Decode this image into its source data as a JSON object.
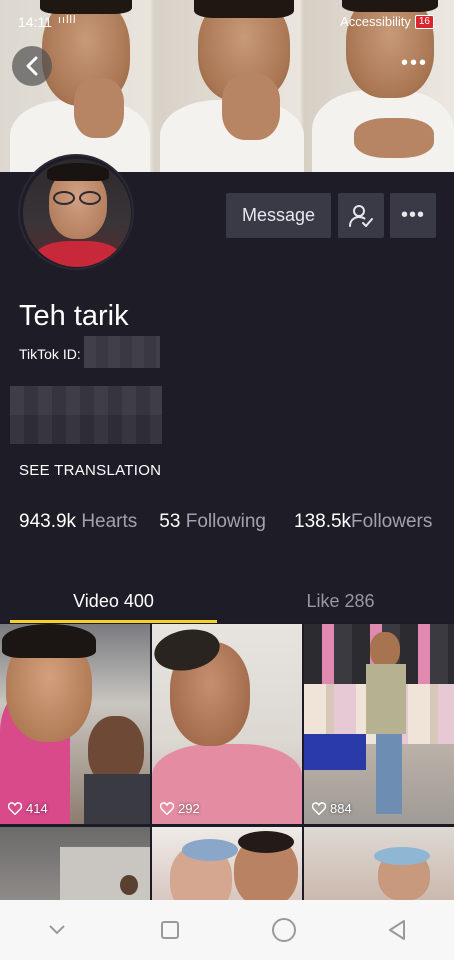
{
  "status_bar": {
    "time": "14:11",
    "signal": "ıılll",
    "accessibility": "Accessibility",
    "battery": "16"
  },
  "profile": {
    "name": "Teh tarik",
    "tiktok_id_label": "TikTok ID:",
    "see_translation": "SEE TRANSLATION",
    "message_label": "Message"
  },
  "stats": {
    "hearts_value": "943.9k",
    "hearts_label": "Hearts",
    "following_value": "53",
    "following_label": "Following",
    "followers_value": "138.5k",
    "followers_label": "Followers"
  },
  "tabs": {
    "video": "Video 400",
    "like": "Like 286"
  },
  "videos": [
    {
      "likes": "414"
    },
    {
      "likes": "292"
    },
    {
      "likes": "884"
    }
  ],
  "colors": {
    "background": "#1d1c27",
    "accent": "#f4d22a",
    "button": "#3a3946"
  }
}
